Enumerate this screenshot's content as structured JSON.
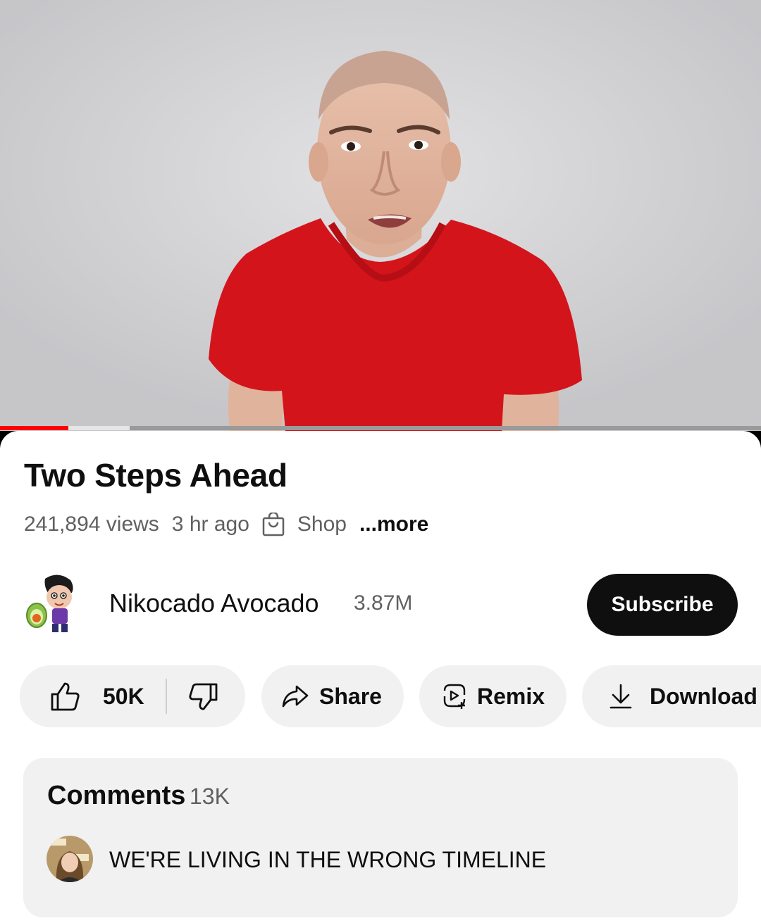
{
  "video": {
    "progress_played": 0.09,
    "progress_buffered": 0.17
  },
  "title": "Two Steps Ahead",
  "meta": {
    "views": "241,894 views",
    "time_ago": "3 hr ago",
    "shop_label": "Shop",
    "more_label": "...more",
    "shop_icon": "shopping-bag-icon"
  },
  "channel": {
    "name": "Nikocado Avocado",
    "subscribers": "3.87M",
    "subscribe_label": "Subscribe",
    "avatar_icon": "channel-avatar"
  },
  "actions": {
    "like_count": "50K",
    "like_icon": "thumbs-up-icon",
    "dislike_icon": "thumbs-down-icon",
    "share_label": "Share",
    "share_icon": "share-arrow-icon",
    "remix_label": "Remix",
    "remix_icon": "remix-icon",
    "download_label": "Download",
    "download_icon": "download-icon"
  },
  "comments": {
    "heading": "Comments",
    "count": "13K",
    "top_comment": "WE'RE LIVING IN THE WRONG TIMELINE",
    "commenter_avatar": "commenter-avatar"
  },
  "colors": {
    "accent_red": "#ff0000",
    "text_primary": "#0f0f0f",
    "text_secondary": "#606060",
    "pill_bg": "#f1f1f1",
    "subscribe_bg": "#0f0f0f"
  }
}
